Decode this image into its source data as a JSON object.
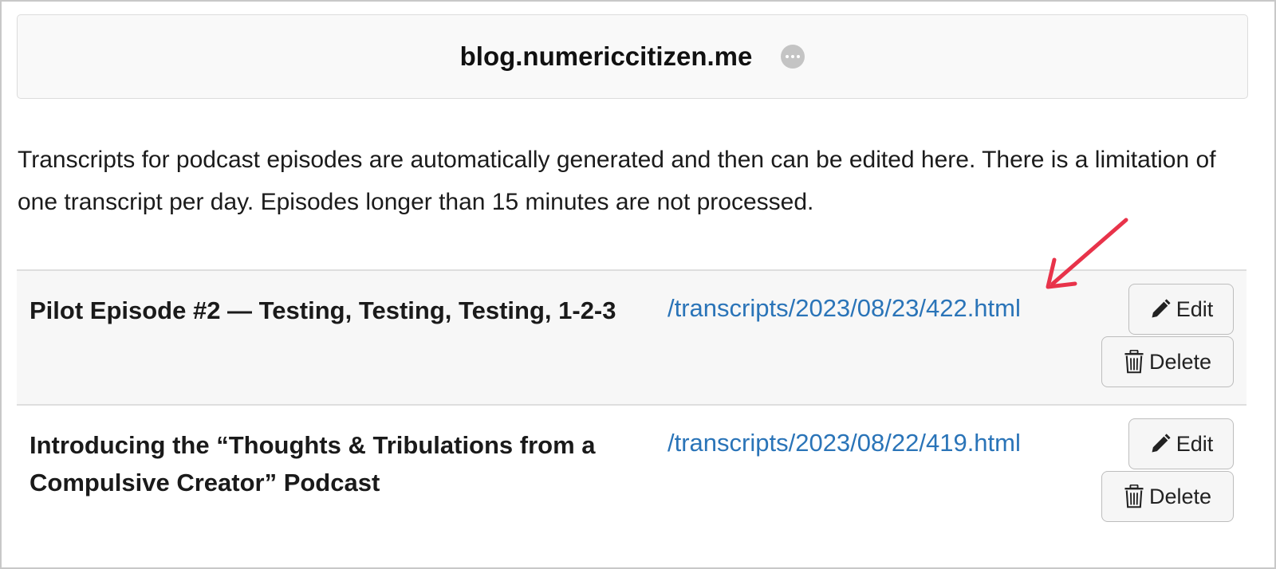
{
  "header": {
    "site_name": "blog.numericcitizen.me",
    "more_icon": "ellipsis-circle-icon"
  },
  "intro_text": "Transcripts for podcast episodes are automatically generated and then can be edited here. There is a limitation of one transcript per day. Episodes longer than 15 minutes are not processed.",
  "episodes": [
    {
      "title": "Pilot Episode #2 — Testing, Testing, Testing, 1-2-3",
      "link": "/transcripts/2023/08/23/422.html",
      "edit_label": "Edit",
      "delete_label": "Delete"
    },
    {
      "title": "Introducing the “Thoughts & Tribulations from a Compulsive Creator” Podcast",
      "link": "/transcripts/2023/08/22/419.html",
      "edit_label": "Edit",
      "delete_label": "Delete"
    }
  ],
  "colors": {
    "link": "#2a74b8",
    "annotation_arrow": "#e8334a"
  },
  "icons": {
    "edit": "pencil-icon",
    "delete": "trash-icon"
  }
}
